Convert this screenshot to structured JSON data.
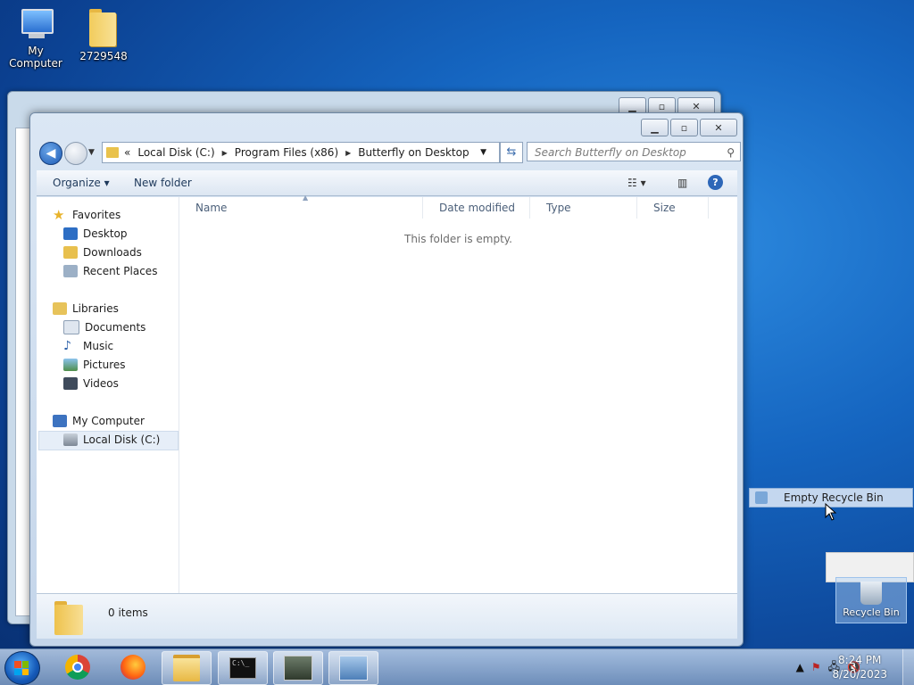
{
  "desktop": {
    "icons": [
      {
        "label": "My Computer"
      },
      {
        "label": "2729548"
      }
    ],
    "recycle_bin": {
      "label": "Recycle Bin"
    }
  },
  "window": {
    "address": {
      "chevron": "«",
      "crumbs": [
        "Local Disk (C:)",
        "Program Files (x86)",
        "Butterfly on Desktop"
      ]
    },
    "search_placeholder": "Search Butterfly on Desktop",
    "toolbar": {
      "organize": "Organize",
      "new_folder": "New folder"
    },
    "nav": {
      "favorites": "Favorites",
      "favorites_items": [
        "Desktop",
        "Downloads",
        "Recent Places"
      ],
      "libraries": "Libraries",
      "libraries_items": [
        "Documents",
        "Music",
        "Pictures",
        "Videos"
      ],
      "computer": "My Computer",
      "computer_items": [
        "Local Disk (C:)"
      ]
    },
    "columns": [
      "Name",
      "Date modified",
      "Type",
      "Size"
    ],
    "empty_message": "This folder is empty.",
    "details": {
      "count": "0 items"
    }
  },
  "context_menu": {
    "items": [
      "Empty Recycle Bin"
    ]
  },
  "taskbar": {
    "clock_time": "8:24 PM",
    "clock_date": "8/20/2023"
  },
  "colors": {
    "desktop": "#1565c0",
    "selection": "#c4d7ef"
  }
}
